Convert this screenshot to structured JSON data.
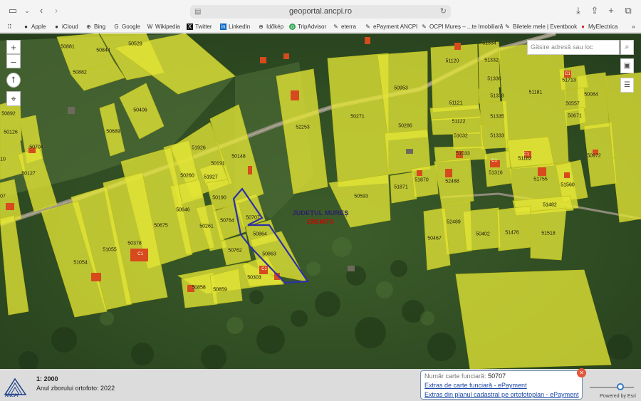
{
  "browser": {
    "url": "geoportal.ancpi.ro",
    "favorites": [
      {
        "label": "Apple",
        "icon": "apple-icon"
      },
      {
        "label": "iCloud",
        "icon": "apple-icon"
      },
      {
        "label": "Bing",
        "icon": "globe-icon"
      },
      {
        "label": "Google",
        "icon": "google-icon"
      },
      {
        "label": "Wikipedia",
        "icon": "wikipedia-icon"
      },
      {
        "label": "Twitter",
        "icon": "x-icon"
      },
      {
        "label": "LinkedIn",
        "icon": "linkedin-icon"
      },
      {
        "label": "Időkép",
        "icon": "globe-icon"
      },
      {
        "label": "TripAdvisor",
        "icon": "tripadvisor-icon"
      },
      {
        "label": "eterra",
        "icon": "pen-icon"
      },
      {
        "label": "ePayment ANCPI",
        "icon": "pen-icon"
      },
      {
        "label": "OCPI Mureș – ...te Imobiliară",
        "icon": "pen-icon"
      },
      {
        "label": "Biletele mele | Eventbook",
        "icon": "ticket-icon"
      },
      {
        "label": "MyElectrica",
        "icon": "electrica-icon"
      }
    ]
  },
  "map": {
    "search_placeholder": "Găsire adresă sau loc",
    "zoom_in": "+",
    "zoom_out": "–",
    "county_label": "JUDEȚUL MUREȘ",
    "locality_label": "EREMITU",
    "plots": [
      {
        "id": "50881"
      },
      {
        "id": "50844"
      },
      {
        "id": "50528"
      },
      {
        "id": "50882"
      },
      {
        "id": "50406"
      },
      {
        "id": "50689"
      },
      {
        "id": "50892"
      },
      {
        "id": "50126"
      },
      {
        "id": "50704"
      },
      {
        "id": "50127"
      },
      {
        "id": "51926"
      },
      {
        "id": "50148"
      },
      {
        "id": "50191"
      },
      {
        "id": "51927"
      },
      {
        "id": "50260"
      },
      {
        "id": "50190"
      },
      {
        "id": "50646"
      },
      {
        "id": "50707"
      },
      {
        "id": "50764"
      },
      {
        "id": "50261"
      },
      {
        "id": "50864"
      },
      {
        "id": "50675"
      },
      {
        "id": "50762"
      },
      {
        "id": "50863"
      },
      {
        "id": "50378"
      },
      {
        "id": "51055"
      },
      {
        "id": "51054"
      },
      {
        "id": "50303"
      },
      {
        "id": "50858"
      },
      {
        "id": "50859"
      },
      {
        "id": "52253"
      },
      {
        "id": "50271"
      },
      {
        "id": "50953"
      },
      {
        "id": "50286"
      },
      {
        "id": "50593"
      },
      {
        "id": "51871"
      },
      {
        "id": "51870"
      },
      {
        "id": "51120"
      },
      {
        "id": "51334"
      },
      {
        "id": "51332"
      },
      {
        "id": "51336"
      },
      {
        "id": "51338"
      },
      {
        "id": "51121"
      },
      {
        "id": "51335"
      },
      {
        "id": "51122"
      },
      {
        "id": "51032"
      },
      {
        "id": "51333"
      },
      {
        "id": "51033"
      },
      {
        "id": "51181"
      },
      {
        "id": "51713"
      },
      {
        "id": "50084"
      },
      {
        "id": "50557"
      },
      {
        "id": "50671"
      },
      {
        "id": "50972"
      },
      {
        "id": "51182"
      },
      {
        "id": "51316"
      },
      {
        "id": "52488"
      },
      {
        "id": "51755"
      },
      {
        "id": "51560"
      },
      {
        "id": "51482"
      },
      {
        "id": "52489"
      },
      {
        "id": "50402"
      },
      {
        "id": "51476"
      },
      {
        "id": "51518"
      },
      {
        "id": "50467"
      },
      {
        "id": "10"
      },
      {
        "id": "07"
      }
    ],
    "c1_markers": [
      "C1",
      "C1",
      "C1",
      "C1",
      "C1"
    ]
  },
  "footer": {
    "scale": "1: 2000",
    "ortho_year": "Anul zborului ortofoto: 2022",
    "logo_text": "ANCPI",
    "info_key": "Număr carte funciară:",
    "info_value": "50707",
    "link1": "Extras de carte funciară - ePayment",
    "link2": "Extras din planul cadastral pe ortofotoplan - ePayment",
    "powered": "Powered by Esri"
  }
}
